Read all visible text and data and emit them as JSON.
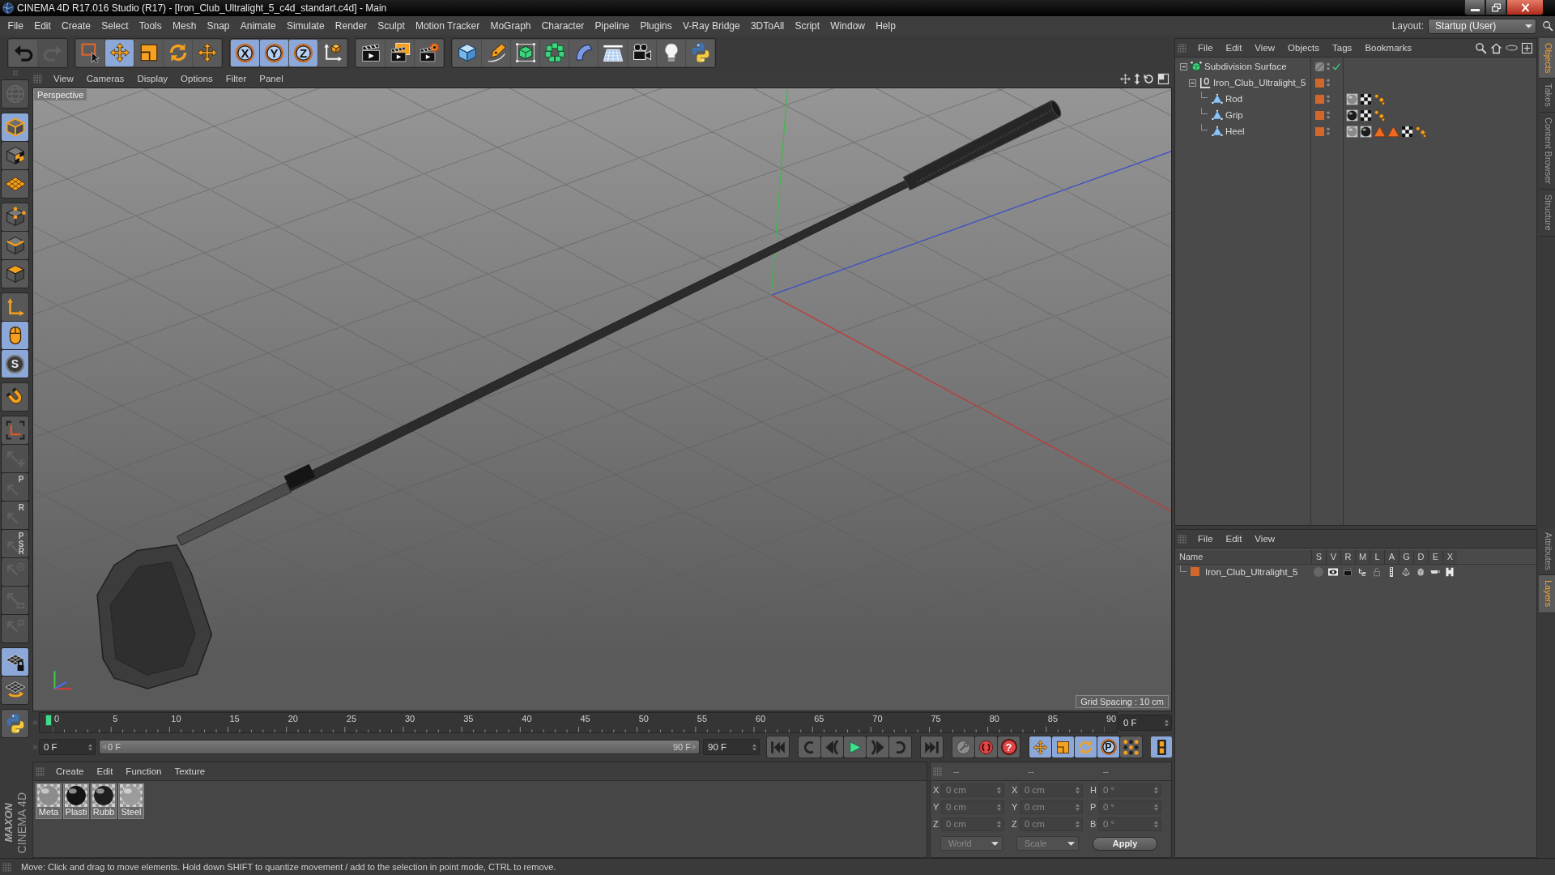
{
  "window": {
    "title": "CINEMA 4D R17.016 Studio (R17) - [Iron_Club_Ultralight_5_c4d_standart.c4d] - Main",
    "controls": [
      {
        "kind": "minimize"
      },
      {
        "kind": "maximize"
      },
      {
        "kind": "close"
      }
    ]
  },
  "menu_bar": {
    "items": [
      "File",
      "Edit",
      "Create",
      "Select",
      "Tools",
      "Mesh",
      "Snap",
      "Animate",
      "Simulate",
      "Render",
      "Sculpt",
      "Motion Tracker",
      "MoGraph",
      "Character",
      "Pipeline",
      "Plugins",
      "V-Ray Bridge",
      "3DToAll",
      "Script",
      "Window",
      "Help"
    ],
    "layout_label": "Layout:",
    "layout_value": "Startup (User)"
  },
  "toolbar": {
    "groups": [
      [
        {
          "kind": "undo",
          "selected": false,
          "disabled": false
        },
        {
          "kind": "redo",
          "selected": false,
          "disabled": true
        }
      ],
      [
        {
          "kind": "live_select",
          "selected": false,
          "disabled": false
        },
        {
          "kind": "move",
          "selected": true,
          "disabled": false
        },
        {
          "kind": "scale",
          "selected": false,
          "disabled": false
        },
        {
          "kind": "rotate",
          "selected": false,
          "disabled": false
        },
        {
          "kind": "last_tool",
          "selected": false,
          "disabled": false
        }
      ],
      [
        {
          "kind": "axis",
          "label": "X",
          "selected": true,
          "disabled": false
        },
        {
          "kind": "axis",
          "label": "Y",
          "selected": true,
          "disabled": false
        },
        {
          "kind": "axis",
          "label": "Z",
          "selected": true,
          "disabled": false
        },
        {
          "kind": "coord_system",
          "selected": false,
          "disabled": false
        }
      ],
      [
        {
          "kind": "render_view",
          "selected": false,
          "disabled": false
        },
        {
          "kind": "render_viewer",
          "selected": false,
          "disabled": false
        },
        {
          "kind": "render_settings",
          "selected": false,
          "disabled": false
        }
      ],
      [
        {
          "kind": "cube",
          "selected": false,
          "disabled": false
        },
        {
          "kind": "pen",
          "selected": false,
          "disabled": false
        },
        {
          "kind": "subdivision",
          "selected": false,
          "disabled": false
        },
        {
          "kind": "cloner",
          "selected": false,
          "disabled": false
        },
        {
          "kind": "bend",
          "selected": false,
          "disabled": false
        },
        {
          "kind": "floor",
          "selected": false,
          "disabled": false
        },
        {
          "kind": "camera",
          "selected": false,
          "disabled": false
        },
        {
          "kind": "light",
          "selected": false,
          "disabled": false
        },
        {
          "kind": "python",
          "selected": false,
          "disabled": false
        }
      ]
    ]
  },
  "left_toolbar": {
    "groups": [
      [
        {
          "kind": "make_editable",
          "selected": false,
          "disabled": true
        }
      ],
      [
        {
          "kind": "model",
          "selected": true,
          "disabled": false
        },
        {
          "kind": "texture",
          "selected": false,
          "disabled": false
        },
        {
          "kind": "workplane",
          "selected": false,
          "disabled": false
        }
      ],
      [
        {
          "kind": "points",
          "selected": false,
          "disabled": false
        },
        {
          "kind": "edges",
          "selected": false,
          "disabled": false
        },
        {
          "kind": "polygons",
          "selected": false,
          "disabled": false
        }
      ],
      [
        {
          "kind": "axis_mode",
          "selected": false,
          "disabled": false
        },
        {
          "kind": "tweak",
          "selected": true,
          "disabled": false
        },
        {
          "kind": "snap",
          "label": "S",
          "selected": true,
          "disabled": false
        }
      ],
      [
        {
          "kind": "magnet",
          "selected": false,
          "disabled": false
        }
      ],
      [
        {
          "kind": "axis_brackets",
          "selected": false,
          "disabled": false
        },
        {
          "kind": "key_move",
          "selected": false,
          "disabled": true
        },
        {
          "kind": "lettered",
          "label": "P",
          "selected": false,
          "disabled": true
        },
        {
          "kind": "lettered",
          "label": "R",
          "selected": false,
          "disabled": true
        },
        {
          "kind": "lettered",
          "label": "PSR",
          "selected": false,
          "disabled": true
        },
        {
          "kind": "key_target",
          "selected": false,
          "disabled": true
        },
        {
          "kind": "key_box",
          "selected": false,
          "disabled": true
        },
        {
          "kind": "key_flag",
          "selected": false,
          "disabled": true
        }
      ],
      [
        {
          "kind": "workplane_lock",
          "selected": true,
          "disabled": false
        },
        {
          "kind": "grid_rotate",
          "selected": false,
          "disabled": false
        }
      ],
      [
        {
          "kind": "python",
          "selected": false,
          "disabled": false
        }
      ]
    ]
  },
  "branding": {
    "company": "MAXON",
    "product": "CINEMA 4D"
  },
  "viewport": {
    "menu": [
      "View",
      "Cameras",
      "Display",
      "Options",
      "Filter",
      "Panel"
    ],
    "camera": "Perspective",
    "grid_spacing": "Grid Spacing : 10 cm"
  },
  "timeline": {
    "ticks": [
      "0",
      "5",
      "10",
      "15",
      "20",
      "25",
      "30",
      "35",
      "40",
      "45",
      "50",
      "55",
      "60",
      "65",
      "70",
      "75",
      "80",
      "85",
      "90"
    ],
    "playhead": {
      "level": 0
    },
    "frame": "0 F",
    "start": "0 F",
    "range_slider": {
      "start": "0 F",
      "end": "90 F",
      "level": 1
    },
    "end": "90 F",
    "transport": [
      [
        {
          "kind": "first"
        }
      ],
      [
        {
          "kind": "prev_key"
        },
        {
          "kind": "prev_frame"
        },
        {
          "kind": "play"
        },
        {
          "kind": "next_frame"
        },
        {
          "kind": "next_key"
        }
      ],
      [
        {
          "kind": "last"
        }
      ]
    ],
    "record": [
      {
        "kind": "autokey"
      },
      {
        "kind": "record"
      },
      {
        "kind": "key_help",
        "label": "?"
      }
    ],
    "key_modes": [
      {
        "kind": "move",
        "selected": true
      },
      {
        "kind": "scale",
        "selected": true
      },
      {
        "kind": "rotate",
        "selected": true
      },
      {
        "kind": "parameter",
        "label": "P",
        "selected": true
      },
      {
        "kind": "points",
        "selected": false
      }
    ],
    "timeline_button": {
      "selected": true
    }
  },
  "materials": {
    "menu": [
      "Create",
      "Edit",
      "Function",
      "Texture"
    ],
    "items": [
      {
        "name": "Meta",
        "color": "#8c8c8c",
        "selected": false
      },
      {
        "name": "Plasti",
        "color": "#141414",
        "selected": false
      },
      {
        "name": "Rubb",
        "color": "#1e1e1e",
        "selected": false
      },
      {
        "name": "Steel",
        "color": "#9c9c9c",
        "selected": false
      }
    ]
  },
  "coordinates": {
    "headers": [
      "--",
      "--",
      "--"
    ],
    "disabled": true,
    "rows": [
      [
        {
          "axis": "X",
          "value": "0 cm"
        },
        {
          "axis": "X",
          "value": "0 cm"
        },
        {
          "axis": "H",
          "value": "0 °"
        }
      ],
      [
        {
          "axis": "Y",
          "value": "0 cm"
        },
        {
          "axis": "Y",
          "value": "0 cm"
        },
        {
          "axis": "P",
          "value": "0 °"
        }
      ],
      [
        {
          "axis": "Z",
          "value": "0 cm"
        },
        {
          "axis": "Z",
          "value": "0 cm"
        },
        {
          "axis": "B",
          "value": "0 °"
        }
      ]
    ],
    "mode": "World",
    "transform": "Scale",
    "apply": "Apply"
  },
  "object_manager": {
    "menu": [
      "File",
      "Edit",
      "View",
      "Objects",
      "Tags",
      "Bookmarks"
    ],
    "objects": [
      {
        "name": "Subdivision Surface",
        "kind": "subdivision",
        "expanded": true,
        "enabled": true,
        "selected": false,
        "children": [
          {
            "name": "Iron_Club_Ultralight_5",
            "kind": "null",
            "expanded": true,
            "selected": false,
            "layer": {
              "color": "#d2672c"
            },
            "children": [
              {
                "name": "Rod",
                "kind": "polygon",
                "selected": false,
                "layer": {
                  "color": "#d2672c"
                },
                "tags": [
                  {
                    "kind": "material",
                    "color": "#8a8a8a"
                  },
                  {
                    "kind": "checker"
                  },
                  {
                    "kind": "dots"
                  }
                ]
              },
              {
                "name": "Grip",
                "kind": "polygon",
                "selected": false,
                "layer": {
                  "color": "#d2672c"
                },
                "tags": [
                  {
                    "kind": "material",
                    "color": "#1c1c1c"
                  },
                  {
                    "kind": "checker"
                  },
                  {
                    "kind": "dots"
                  }
                ]
              },
              {
                "name": "Heel",
                "kind": "polygon",
                "selected": false,
                "layer": {
                  "color": "#d2672c"
                },
                "tags": [
                  {
                    "kind": "material",
                    "color": "#8a8a8a"
                  },
                  {
                    "kind": "material",
                    "color": "#1c1c1c"
                  },
                  {
                    "kind": "triangle"
                  },
                  {
                    "kind": "triangle"
                  },
                  {
                    "kind": "checker"
                  },
                  {
                    "kind": "dots"
                  }
                ]
              }
            ]
          }
        ]
      }
    ]
  },
  "layer_manager": {
    "menu": [
      "File",
      "Edit",
      "View"
    ],
    "columns": [
      "Name",
      "S",
      "V",
      "R",
      "M",
      "L",
      "A",
      "G",
      "D",
      "E",
      "X"
    ],
    "layers": [
      {
        "name": "Iron_Club_Ultralight_5",
        "color": "#d2672c",
        "selected": false,
        "switches": [
          {
            "kind": "solo",
            "on": false
          },
          {
            "kind": "visible",
            "on": true
          },
          {
            "kind": "render",
            "on": true
          },
          {
            "kind": "manager",
            "on": true
          },
          {
            "kind": "lock",
            "on": false
          },
          {
            "kind": "animation",
            "on": true
          },
          {
            "kind": "generators",
            "on": true
          },
          {
            "kind": "deformers",
            "on": true
          },
          {
            "kind": "expressions",
            "on": true
          },
          {
            "kind": "xref",
            "on": true
          }
        ]
      }
    ]
  },
  "side_tabs": {
    "upper": [
      {
        "label": "Objects",
        "selected": true
      },
      {
        "label": "Takes",
        "selected": false
      },
      {
        "label": "Content Browser",
        "selected": false
      },
      {
        "label": "Structure",
        "selected": false
      }
    ],
    "lower": [
      {
        "label": "Attributes",
        "selected": false
      },
      {
        "label": "Layers",
        "selected": true
      }
    ]
  },
  "status_bar": {
    "text": "Move: Click and drag to move elements. Hold down SHIFT to quantize movement / add to the selection in point mode, CTRL to remove."
  }
}
